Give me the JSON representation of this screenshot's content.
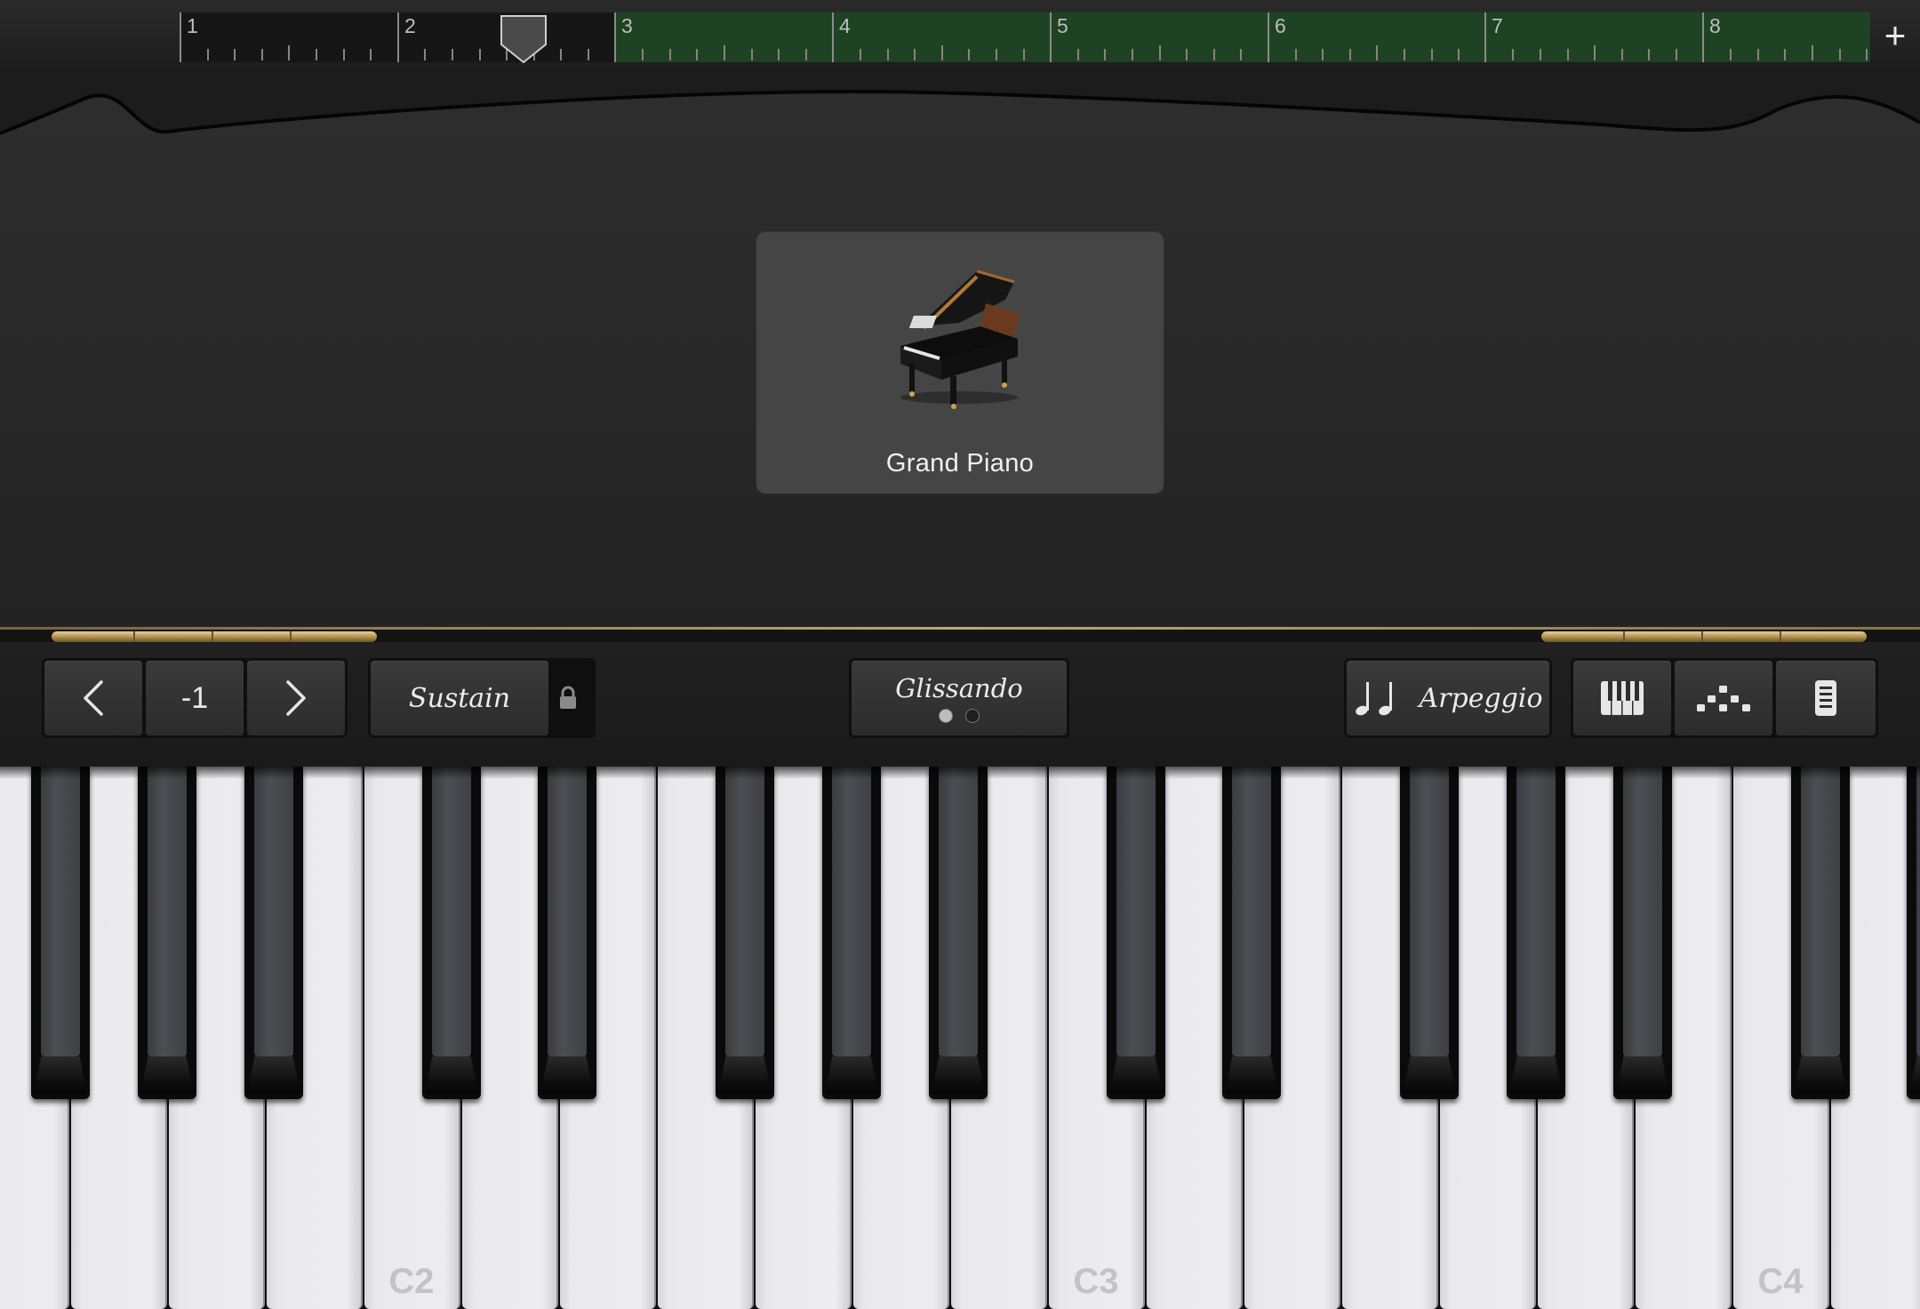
{
  "ruler": {
    "bars": [
      "1",
      "2",
      "3",
      "4",
      "5",
      "6",
      "7",
      "8"
    ],
    "add_label": "+"
  },
  "instrument": {
    "name": "Grand Piano",
    "icon": "grand-piano-image"
  },
  "octave": {
    "prev_icon": "chevron-left-icon",
    "value": "-1",
    "next_icon": "chevron-right-icon"
  },
  "sustain": {
    "label": "Sustain",
    "lock_icon": "lock-icon"
  },
  "glissando": {
    "label": "Glissando",
    "page_count": 2,
    "active_page": 0
  },
  "arpeggiator": {
    "icon": "notes-icon",
    "label": "Arpeggio"
  },
  "view_buttons": {
    "keyboard_icon": "keyboard-layout-icon",
    "scale_icon": "scale-layout-icon",
    "settings_icon": "keyboard-settings-icon"
  },
  "keyboard": {
    "octave_labels": [
      "C2",
      "C3",
      "C4"
    ]
  },
  "colors": {
    "region": "#1e4322",
    "gold": "#c3a66a",
    "panel": "#2b2b2b"
  }
}
